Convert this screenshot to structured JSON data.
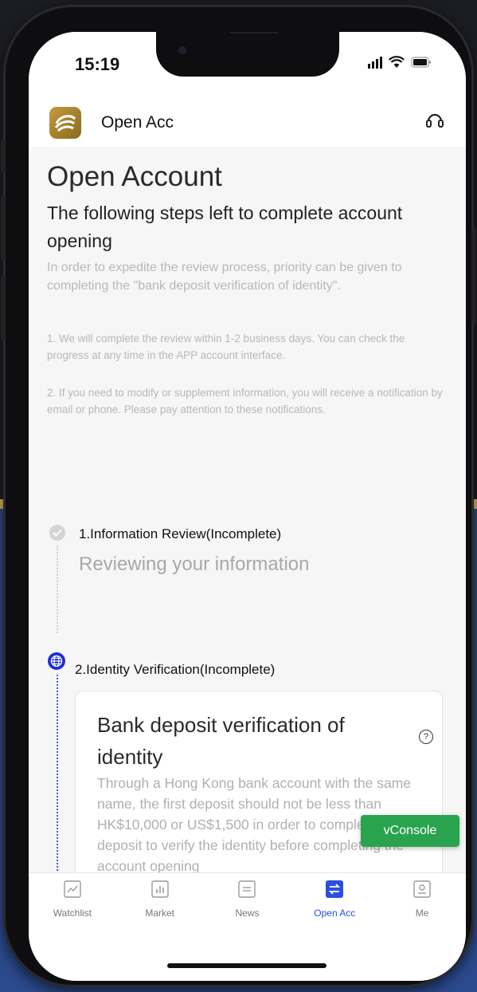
{
  "status_bar": {
    "time": "15:19"
  },
  "header": {
    "title": "Open Acc"
  },
  "page": {
    "title": "Open Account",
    "subtitle": "The following steps left to complete account opening",
    "priority_note": "In order to expedite the review process, priority can be given to completing the \"bank deposit verification of identity\".",
    "notes": [
      "1. We will complete the review within 1-2 business days. You can check the progress at any time in the APP account interface.",
      "2. If you need to modify or supplement information, you will receive a notification by email or phone. Please pay attention to these notifications."
    ]
  },
  "steps": [
    {
      "title": "1.Information Review(Incomplete)",
      "subtitle": "Reviewing your information"
    },
    {
      "title": "2.Identity Verification(Incomplete)"
    }
  ],
  "card": {
    "title": "Bank deposit verification of identity",
    "help": "?",
    "description": "Through a Hong Kong bank account with the same name, the first deposit should not be less than HK$10,000 or US$1,500 in order to complete the deposit to verify the identity before completing the account opening"
  },
  "vconsole": {
    "label": "vConsole"
  },
  "tabs": [
    {
      "label": "Watchlist",
      "icon": "chart-line-icon"
    },
    {
      "label": "Market",
      "icon": "bar-chart-icon"
    },
    {
      "label": "News",
      "icon": "news-icon"
    },
    {
      "label": "Open Acc",
      "icon": "transfer-icon",
      "active": true
    },
    {
      "label": "Me",
      "icon": "profile-icon"
    }
  ],
  "colors": {
    "accent": "#2d4fe0",
    "console": "#2aa34f",
    "step_active": "#1b2fd6"
  }
}
